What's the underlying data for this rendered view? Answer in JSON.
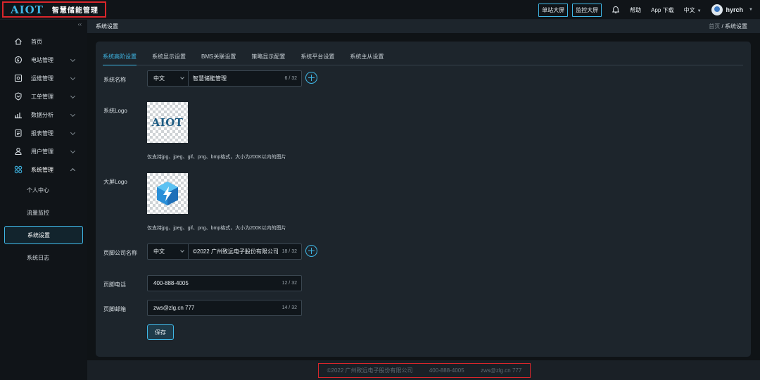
{
  "header": {
    "brand_logo": "AIOT",
    "brand_name": "智慧储能管理",
    "buttons": [
      "单站大屏",
      "监控大屏"
    ],
    "help": "帮助",
    "app_download": "App 下载",
    "language": "中文",
    "username": "hyrch"
  },
  "sidebar": {
    "collapse": "‹‹",
    "items": [
      {
        "label": "首页"
      },
      {
        "label": "电站管理"
      },
      {
        "label": "运维管理"
      },
      {
        "label": "工单管理"
      },
      {
        "label": "数据分析"
      },
      {
        "label": "报表管理"
      },
      {
        "label": "用户管理"
      },
      {
        "label": "系统管理"
      }
    ],
    "sub_items": [
      {
        "label": "个人中心"
      },
      {
        "label": "流量监控"
      },
      {
        "label": "系统设置"
      },
      {
        "label": "系统日志"
      }
    ]
  },
  "breadcrumb": {
    "title": "系统设置",
    "home": "首页",
    "sep": "/",
    "current": "系统设置"
  },
  "tabs": [
    "系统高阶设置",
    "系统显示设置",
    "BMS关联设置",
    "策略显示配置",
    "系统平台设置",
    "系统主从设置"
  ],
  "form": {
    "system_name": {
      "label": "系统名称",
      "lang": "中文",
      "value": "智慧储能管理",
      "count": "6 / 32"
    },
    "system_logo": {
      "label": "系统Logo",
      "logo_text": "AIOT",
      "hint": "仅支持jpg、jpeg、gif、png、bmp格式，大小为200K以内的图片"
    },
    "big_logo": {
      "label": "大屏Logo",
      "hint": "仅支持jpg、jpeg、gif、png、bmp格式，大小为200K以内的图片"
    },
    "company": {
      "label": "页脚公司名称",
      "lang": "中文",
      "value": "©2022 广州致远电子股份有限公司",
      "count": "18 / 32"
    },
    "phone": {
      "label": "页脚电话",
      "value": "400-888-4005",
      "count": "12 / 32"
    },
    "email": {
      "label": "页脚邮箱",
      "value": "zws@zlg.cn 777",
      "count": "14 / 32"
    },
    "save_label": "保存"
  },
  "footer": {
    "company": "©2022 广州致远电子股份有限公司",
    "phone": "400-888-4005",
    "email": "zws@zlg.cn 777"
  },
  "colors": {
    "accent": "#3fb7e6",
    "highlight": "#d9262b"
  }
}
